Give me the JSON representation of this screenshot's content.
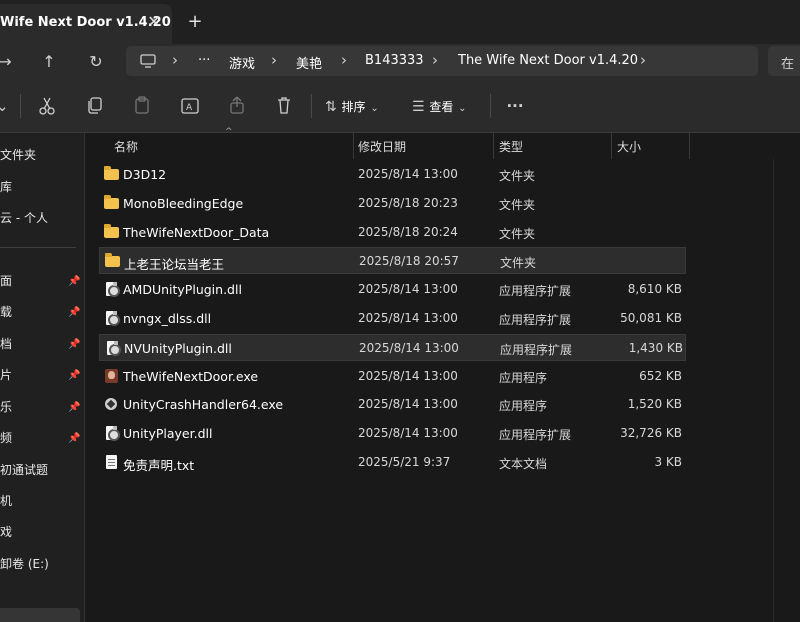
{
  "tab": {
    "title": "Wife Next Door v1.4.20",
    "close": "✕",
    "new": "+"
  },
  "nav": {
    "back": "→",
    "up": "↑",
    "refresh": "↻",
    "breadcrumb": [
      "游戏",
      "美艳",
      "B143333",
      "The Wife Next Door v1.4.20"
    ],
    "more": "···",
    "search_partial": "在"
  },
  "toolbar": {
    "sort_label": "排序",
    "view_label": "查看",
    "more": "···"
  },
  "sidebar": {
    "items": [
      {
        "label": "文件夹",
        "pinned": false
      },
      {
        "label": "库",
        "pinned": false
      },
      {
        "label": "云 - 个人",
        "pinned": false
      },
      {
        "label": "面",
        "pinned": true
      },
      {
        "label": "载",
        "pinned": true
      },
      {
        "label": "档",
        "pinned": true
      },
      {
        "label": "片",
        "pinned": true
      },
      {
        "label": "乐",
        "pinned": true
      },
      {
        "label": "频",
        "pinned": true
      },
      {
        "label": "初通试题",
        "pinned": false
      },
      {
        "label": "机",
        "pinned": false
      },
      {
        "label": "戏",
        "pinned": false
      },
      {
        "label": "卸卷 (E:)",
        "pinned": false
      }
    ]
  },
  "columns": {
    "name": "名称",
    "date": "修改日期",
    "type": "类型",
    "size": "大小"
  },
  "files": [
    {
      "name": "D3D12",
      "date": "2025/8/14 13:00",
      "type": "文件夹",
      "size": "",
      "icon": "folder-icon"
    },
    {
      "name": "MonoBleedingEdge",
      "date": "2025/8/18 20:23",
      "type": "文件夹",
      "size": "",
      "icon": "folder-icon"
    },
    {
      "name": "TheWifeNextDoor_Data",
      "date": "2025/8/18 20:24",
      "type": "文件夹",
      "size": "",
      "icon": "folder-icon"
    },
    {
      "name": "上老王论坛当老王",
      "date": "2025/8/18 20:57",
      "type": "文件夹",
      "size": "",
      "icon": "folder-icon",
      "selected": true
    },
    {
      "name": "AMDUnityPlugin.dll",
      "date": "2025/8/14 13:00",
      "type": "应用程序扩展",
      "size": "8,610 KB",
      "icon": "dll-icon"
    },
    {
      "name": "nvngx_dlss.dll",
      "date": "2025/8/14 13:00",
      "type": "应用程序扩展",
      "size": "50,081 KB",
      "icon": "dll-icon"
    },
    {
      "name": "NVUnityPlugin.dll",
      "date": "2025/8/14 13:00",
      "type": "应用程序扩展",
      "size": "1,430 KB",
      "icon": "dll-icon",
      "selected": true
    },
    {
      "name": "TheWifeNextDoor.exe",
      "date": "2025/8/14 13:00",
      "type": "应用程序",
      "size": "652 KB",
      "icon": "exe-icon"
    },
    {
      "name": "UnityCrashHandler64.exe",
      "date": "2025/8/14 13:00",
      "type": "应用程序",
      "size": "1,520 KB",
      "icon": "crash-handler-icon"
    },
    {
      "name": "UnityPlayer.dll",
      "date": "2025/8/14 13:00",
      "type": "应用程序扩展",
      "size": "32,726 KB",
      "icon": "dll-icon"
    },
    {
      "name": "免责声明.txt",
      "date": "2025/5/21 9:37",
      "type": "文本文档",
      "size": "3 KB",
      "icon": "text-file-icon"
    }
  ]
}
